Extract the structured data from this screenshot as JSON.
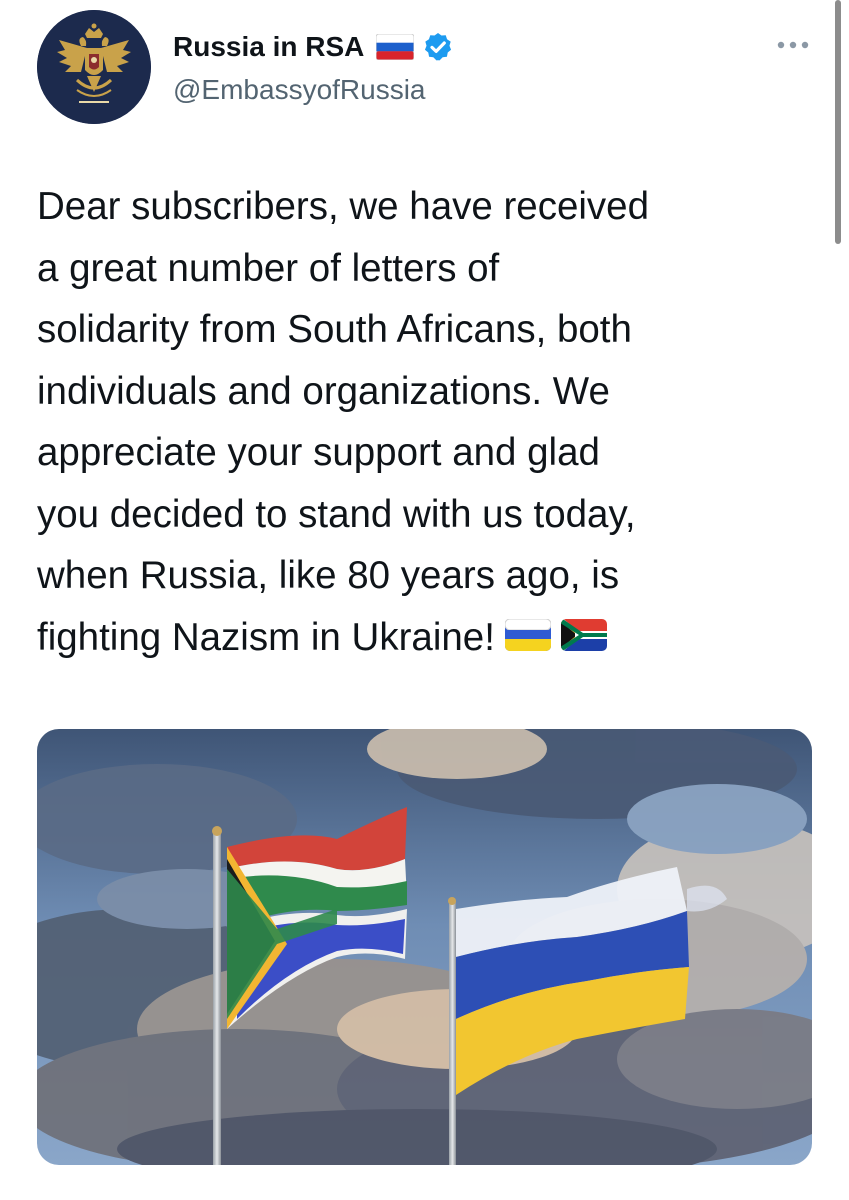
{
  "account": {
    "display_name": "Russia in RSA",
    "handle": "@EmbassyofRussia",
    "verified": true,
    "avatar_icon": "double-headed-eagle-emblem",
    "name_flag_icon": "russia-flag-icon"
  },
  "tweet": {
    "lines": [
      "Dear subscribers, we have received",
      "a great number of letters of",
      "solidarity from South Africans, both",
      "individuals and organizations. We",
      "appreciate your support and glad",
      "you decided to stand with us today,",
      "when Russia, like 80 years ago, is",
      "fighting Nazism in Ukraine!"
    ],
    "trailing_emojis": [
      "ukraine-flag-icon",
      "south-africa-flag-icon"
    ]
  },
  "media": {
    "type": "photo",
    "subject_icons": [
      "south-africa-flag-icon",
      "altered-russia-ukraine-flag-icon"
    ]
  },
  "colors": {
    "text_primary": "#0f1419",
    "text_secondary": "#536471",
    "verified_blue": "#1d9bf0",
    "avatar_bg": "#1c2a4d",
    "emblem_gold": "#c9a24a"
  }
}
